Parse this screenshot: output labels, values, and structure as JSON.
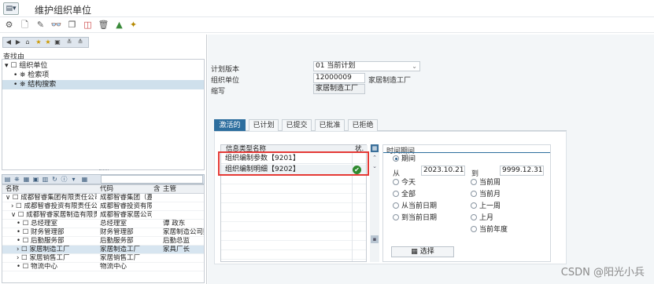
{
  "window": {
    "title": "维护组织单位",
    "title_icon": "menu-icon"
  },
  "toolbar": {
    "icons": [
      "transport-icon",
      "new-document-icon",
      "edit-pencil-icon",
      "display-glasses-icon",
      "copy-icon",
      "delimit-icon",
      "delete-trash-icon",
      "chart-icon",
      "magic-wand-icon"
    ]
  },
  "left": {
    "find_label": "查找由",
    "find_tree": [
      {
        "label": "组织单位",
        "level": 0,
        "prefix": "▾ ☐"
      },
      {
        "label": "检索项",
        "level": 1,
        "prefix": "•"
      },
      {
        "label": "结构搜索",
        "level": 1,
        "prefix": "•",
        "selected": true
      }
    ],
    "grid_headers": [
      "名称",
      "代码",
      "含",
      "主管"
    ],
    "grid_rows": [
      {
        "prefix": "∨ ☐",
        "name": "成都智睿集团有限责任公司",
        "code": "成都智睿集团（嘉",
        "ind": "",
        "mgr": "",
        "level": 0
      },
      {
        "prefix": "› ☐",
        "name": "成都智睿投资有限责任公司",
        "code": "成都智睿投资有限",
        "ind": "",
        "mgr": "",
        "level": 1
      },
      {
        "prefix": "∨ ☐",
        "name": "成都智睿家居制造有限责任",
        "code": "成都智睿家居公司",
        "ind": "",
        "mgr": "",
        "level": 1
      },
      {
        "prefix": "• ☐",
        "name": "总经理室",
        "code": "总经理室",
        "ind": "",
        "mgr": "谭 政东",
        "level": 2
      },
      {
        "prefix": "• ☐",
        "name": "财务管理部",
        "code": "财务管理部",
        "ind": "",
        "mgr": "家居制造公司财",
        "level": 2
      },
      {
        "prefix": "• ☐",
        "name": "后勤服务部",
        "code": "后勤服务部",
        "ind": "",
        "mgr": "后勤总监",
        "level": 2
      },
      {
        "prefix": "› ☐",
        "name": "家居制造工厂",
        "code": "家居制造工厂",
        "ind": "",
        "mgr": "家具厂长",
        "level": 2,
        "selected": true
      },
      {
        "prefix": "› ☐",
        "name": "家居销售工厂",
        "code": "家居销售工厂",
        "ind": "",
        "mgr": "",
        "level": 2
      },
      {
        "prefix": "• ☐",
        "name": "物流中心",
        "code": "物流中心",
        "ind": "",
        "mgr": "",
        "level": 2
      }
    ]
  },
  "form": {
    "plan_version_label": "计划版本",
    "plan_version_value": "01 当前计划",
    "org_unit_label": "组织单位",
    "org_unit_code": "12000009",
    "org_unit_name": "家居制造工厂",
    "abbr_label": "缩写",
    "abbr_value": "家居制造工厂"
  },
  "tabs": [
    "激活的",
    "已计划",
    "已提交",
    "已批准",
    "已拒绝"
  ],
  "info_table": {
    "headers": [
      "信息类型名称",
      "状."
    ],
    "rows": [
      {
        "name": "组织编制参数【9201】",
        "status": ""
      },
      {
        "name": "组织编制明细【9202】",
        "status": "✔"
      }
    ]
  },
  "time_period": {
    "title": "时间期间",
    "period_label": "期间",
    "from_label": "从",
    "from_value": "2023.10.21",
    "to_label": "到",
    "to_value": "9999.12.31",
    "options_left": [
      "今天",
      "全部",
      "从当前日期",
      "到当前日期"
    ],
    "options_right": [
      "当前周",
      "当前月",
      "上一周",
      "上月",
      "当前年度"
    ],
    "select_button": "选择"
  },
  "watermark": "CSDN @阳光小兵"
}
